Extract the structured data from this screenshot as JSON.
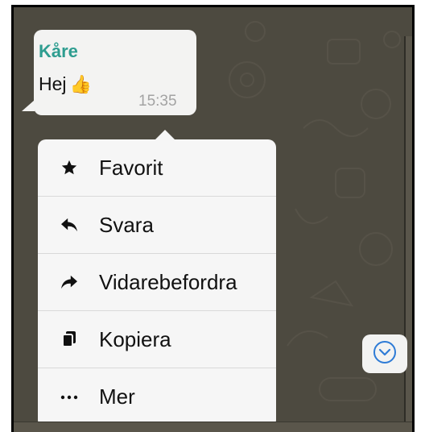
{
  "chat": {
    "sender": "Kåre",
    "message_text": "Hej",
    "message_emoji": "👍",
    "time": "15:35",
    "sender_color": "#2e9d90"
  },
  "menu": {
    "items": [
      {
        "label": "Favorit",
        "icon": "star-icon"
      },
      {
        "label": "Svara",
        "icon": "reply-icon"
      },
      {
        "label": "Vidarebefordra",
        "icon": "forward-icon"
      },
      {
        "label": "Kopiera",
        "icon": "copy-icon"
      },
      {
        "label": "Mer",
        "icon": "more-icon"
      }
    ]
  },
  "scroll_button": {
    "icon": "chevron-down-circle-icon",
    "color": "#2e7bd6"
  }
}
